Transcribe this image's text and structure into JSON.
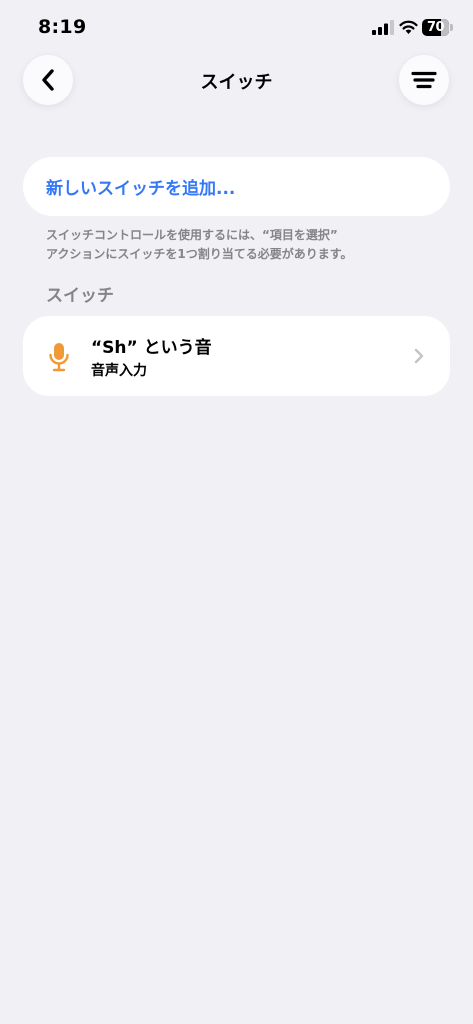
{
  "status_bar": {
    "time": "8:19",
    "battery_percent": 70,
    "battery_label": "70"
  },
  "nav": {
    "title": "スイッチ",
    "back_icon": "chevron-left-icon",
    "menu_icon": "menu-lines-icon"
  },
  "add_switch": {
    "label": "新しいスイッチを追加..."
  },
  "footnote": {
    "line1": "スイッチコントロールを使用するには、“項目を選択”",
    "line2": "アクションにスイッチを1つ割り当てる必要があります。"
  },
  "section": {
    "header": "スイッチ"
  },
  "switches": [
    {
      "title": "“Sh” という音",
      "subtitle": "音声入力",
      "icon": "microphone-icon",
      "icon_color": "#f09a37"
    }
  ],
  "colors": {
    "accent": "#3478f6",
    "background": "#f1f0f5",
    "secondary_text": "#858589",
    "mic": "#f09a37"
  }
}
